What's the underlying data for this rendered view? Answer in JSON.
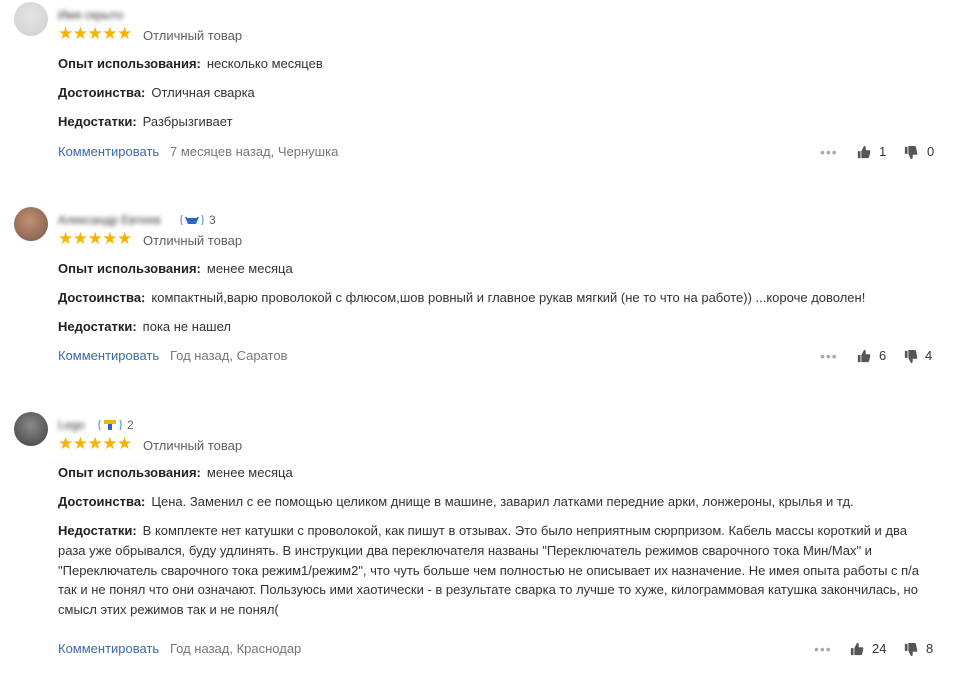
{
  "reviews": [
    {
      "author": "Имя скрыто",
      "badge_level": "",
      "rating_label": "Отличный товар",
      "stars": "★★★★★",
      "usage_label": "Опыт использования:",
      "usage": "несколько месяцев",
      "pros_label": "Достоинства:",
      "pros": "Отличная сварка",
      "cons_label": "Недостатки:",
      "cons": "Разбрызгивает",
      "comment_label": "Комментировать",
      "meta": "7 месяцев назад, Чернушка",
      "more": "•••",
      "likes": "1",
      "dislikes": "0"
    },
    {
      "author": "Александр Евтеев",
      "badge_level": "3",
      "rating_label": "Отличный товар",
      "stars": "★★★★★",
      "usage_label": "Опыт использования:",
      "usage": "менее месяца",
      "pros_label": "Достоинства:",
      "pros": "компактный,варю проволокой с флюсом,шов ровный и главное рукав мягкий (не то что на работе)) ...короче доволен!",
      "cons_label": "Недостатки:",
      "cons": "пока не нашел",
      "comment_label": "Комментировать",
      "meta": "Год назад, Саратов",
      "more": "•••",
      "likes": "6",
      "dislikes": "4"
    },
    {
      "author": "Lego",
      "badge_level": "2",
      "rating_label": "Отличный товар",
      "stars": "★★★★★",
      "usage_label": "Опыт использования:",
      "usage": "менее месяца",
      "pros_label": "Достоинства:",
      "pros": "Цена. Заменил с ее помощью целиком днище в машине, заварил латками передние арки, лонжероны, крылья и тд.",
      "cons_label": "Недостатки:",
      "cons": "В комплекте нет катушки с проволокой, как пишут в отзывах. Это было неприятным сюрпризом. Кабель массы короткий и два раза уже обрывался, буду удлинять. В инструкции два переключателя названы \"Переключатель режимов сварочного тока Мин/Max\" и \"Переключатель сварочного тока режим1/режим2\", что чуть больше чем полностью не описывает их назначение. Не имея опыта работы с п/а так и не понял что они означают. Пользуюсь ими хаотически - в результате сварка то лучше то хуже, килограммовая катушка закончилась, но смысл этих режимов так и не понял(",
      "comment_label": "Комментировать",
      "meta": "Год назад, Краснодар",
      "more": "•••",
      "likes": "24",
      "dislikes": "8"
    }
  ],
  "colors": {
    "star": "#f6b400",
    "link": "#3d6aa6",
    "muted": "#777777"
  },
  "icons": {
    "like": "thumbs-up-icon",
    "dislike": "thumbs-down-icon",
    "more": "more-dots-icon",
    "badge": "reviewer-level-badge-icon"
  }
}
